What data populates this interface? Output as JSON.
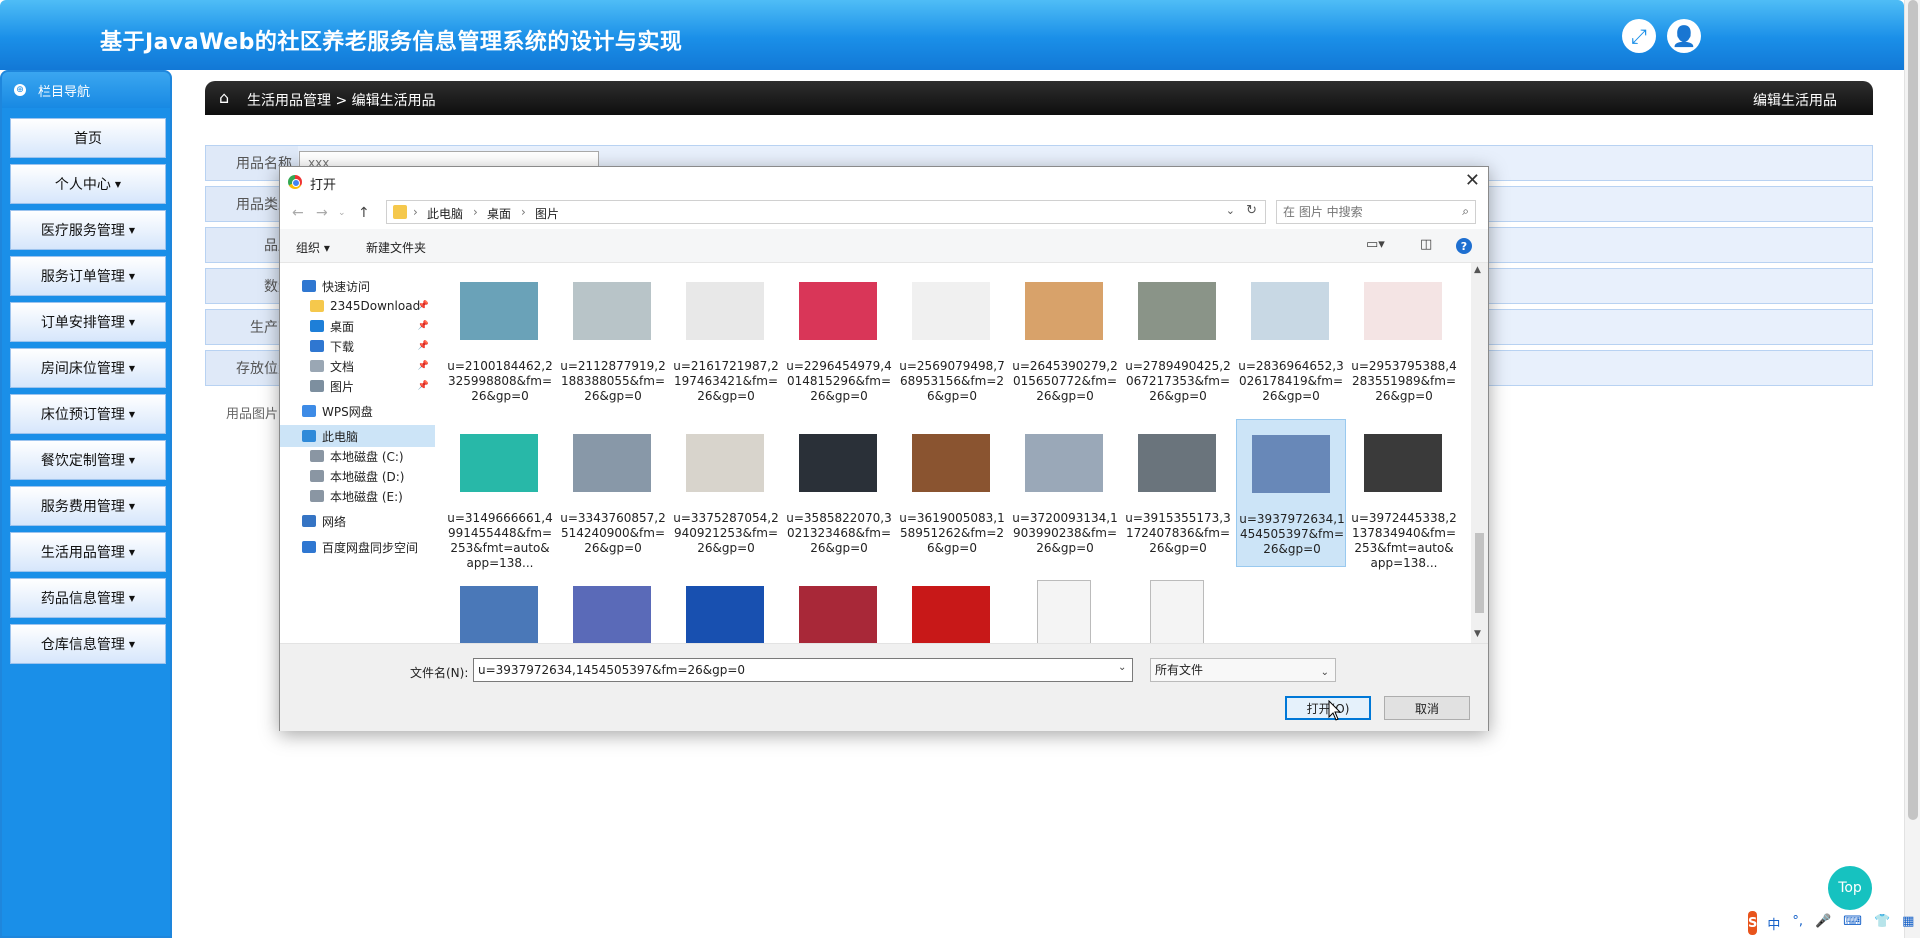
{
  "app": {
    "title": "基于JavaWeb的社区养老服务信息管理系统的设计与实现"
  },
  "sidebar": {
    "heading": "栏目导航",
    "items": [
      {
        "label": "首页",
        "caret": false
      },
      {
        "label": "个人中心",
        "caret": true
      },
      {
        "label": "医疗服务管理",
        "caret": true
      },
      {
        "label": "服务订单管理",
        "caret": true
      },
      {
        "label": "订单安排管理",
        "caret": true
      },
      {
        "label": "房间床位管理",
        "caret": true
      },
      {
        "label": "床位预订管理",
        "caret": true
      },
      {
        "label": "餐饮定制管理",
        "caret": true
      },
      {
        "label": "服务费用管理",
        "caret": true
      },
      {
        "label": "生活用品管理",
        "caret": true
      },
      {
        "label": "药品信息管理",
        "caret": true
      },
      {
        "label": "仓库信息管理",
        "caret": true
      }
    ]
  },
  "breadcrumb": {
    "root": "生活用品管理",
    "separator": ">",
    "current": "编辑生活用品",
    "right_title": "编辑生活用品"
  },
  "form": {
    "fields": [
      {
        "label": "用品名称",
        "value": "xxx"
      },
      {
        "label": "用品类型",
        "value": ""
      },
      {
        "label": "品牌",
        "value": ""
      },
      {
        "label": "数量",
        "value": ""
      },
      {
        "label": "生产商",
        "value": ""
      },
      {
        "label": "存放位置",
        "value": ""
      }
    ],
    "image_label": "用品图片"
  },
  "dialog": {
    "title": "打开",
    "close": "✕",
    "path": [
      "此电脑",
      "桌面",
      "图片"
    ],
    "search_placeholder": "在 图片 中搜索",
    "toolbar": {
      "organize": "组织 ▾",
      "new_folder": "新建文件夹",
      "help": "?"
    },
    "nav": [
      {
        "label": "快速访问",
        "icon": "star-icon",
        "color": "#2f77d1",
        "pinned": false,
        "indent": 1
      },
      {
        "label": "2345Download",
        "icon": "folder-icon",
        "color": "#f5c84c",
        "pinned": true,
        "indent": 2
      },
      {
        "label": "桌面",
        "icon": "desktop-icon",
        "color": "#1e7fd8",
        "pinned": true,
        "indent": 2
      },
      {
        "label": "下载",
        "icon": "download-icon",
        "color": "#2f77d1",
        "pinned": true,
        "indent": 2
      },
      {
        "label": "文档",
        "icon": "document-icon",
        "color": "#9aa7b4",
        "pinned": true,
        "indent": 2
      },
      {
        "label": "图片",
        "icon": "pictures-icon",
        "color": "#7d8f9f",
        "pinned": true,
        "indent": 2
      },
      {
        "label": "WPS网盘",
        "icon": "cloud-icon",
        "color": "#3d8be6",
        "pinned": false,
        "indent": 1
      },
      {
        "label": "此电脑",
        "icon": "computer-icon",
        "color": "#2f8ad9",
        "pinned": false,
        "indent": 1,
        "selected": true
      },
      {
        "label": "本地磁盘 (C:)",
        "icon": "drive-icon",
        "color": "#8a96a3",
        "pinned": false,
        "indent": 2
      },
      {
        "label": "本地磁盘 (D:)",
        "icon": "drive-icon",
        "color": "#8a96a3",
        "pinned": false,
        "indent": 2
      },
      {
        "label": "本地磁盘 (E:)",
        "icon": "drive-icon",
        "color": "#8a96a3",
        "pinned": false,
        "indent": 2
      },
      {
        "label": "网络",
        "icon": "network-icon",
        "color": "#3574c4",
        "pinned": false,
        "indent": 1
      },
      {
        "label": "百度网盘同步空间",
        "icon": "sync-icon",
        "color": "#2f77d1",
        "pinned": false,
        "indent": 1
      }
    ],
    "files": [
      {
        "name": "u=2100184462,2325998808&fm=26&gp=0",
        "color": "#6aa2b8"
      },
      {
        "name": "u=2112877919,2188388055&fm=26&gp=0",
        "color": "#b8c4c8"
      },
      {
        "name": "u=2161721987,2197463421&fm=26&gp=0",
        "color": "#e8e8e8"
      },
      {
        "name": "u=2296454979,4014815296&fm=26&gp=0",
        "color": "#d93658"
      },
      {
        "name": "u=2569079498,768953156&fm=26&gp=0",
        "color": "#f0f0f0"
      },
      {
        "name": "u=2645390279,2015650772&fm=26&gp=0",
        "color": "#d8a26a"
      },
      {
        "name": "u=2789490425,2067217353&fm=26&gp=0",
        "color": "#8a9488"
      },
      {
        "name": "u=2836964652,3026178419&fm=26&gp=0",
        "color": "#c8d8e4"
      },
      {
        "name": "u=2953795388,4283551989&fm=26&gp=0",
        "color": "#f4e4e4"
      },
      {
        "name": "u=3149666661,4991455448&fm=253&fmt=auto&app=138...",
        "color": "#28b8a8"
      },
      {
        "name": "u=3343760857,2514240900&fm=26&gp=0",
        "color": "#8898a8"
      },
      {
        "name": "u=3375287054,2940921253&fm=26&gp=0",
        "color": "#d8d4cc"
      },
      {
        "name": "u=3585822070,3021323468&fm=26&gp=0",
        "color": "#2a3038"
      },
      {
        "name": "u=3619005083,158951262&fm=26&gp=0",
        "color": "#8a5430"
      },
      {
        "name": "u=3720093134,1903990238&fm=26&gp=0",
        "color": "#9aa8b8"
      },
      {
        "name": "u=3915355173,3172407836&fm=26&gp=0",
        "color": "#6a747c"
      },
      {
        "name": "u=3937972634,1454505397&fm=26&gp=0",
        "color": "#6888b8",
        "selected": true
      },
      {
        "name": "u=3972445338,2137834940&fm=253&fmt=auto&app=138...",
        "color": "#3a3a3a"
      },
      {
        "name": "",
        "color": "#4a78b8"
      },
      {
        "name": "",
        "color": "#5a6ab8"
      },
      {
        "name": "",
        "color": "#1850b0"
      },
      {
        "name": "",
        "color": "#a82838"
      },
      {
        "name": "",
        "color": "#c81818"
      },
      {
        "name": "",
        "color": "#f4f4f4"
      },
      {
        "name": "",
        "color": "#f4f4f4"
      }
    ],
    "filename_label": "文件名(N):",
    "filename_value": "u=3937972634,1454505397&fm=26&gp=0",
    "filter": "所有文件",
    "open_button": "打开(O)",
    "cancel_button": "取消"
  },
  "floating": {
    "top_button": "Top",
    "ime": [
      "中",
      "°,",
      "🎤",
      "⌨",
      "👕",
      "▦"
    ]
  }
}
